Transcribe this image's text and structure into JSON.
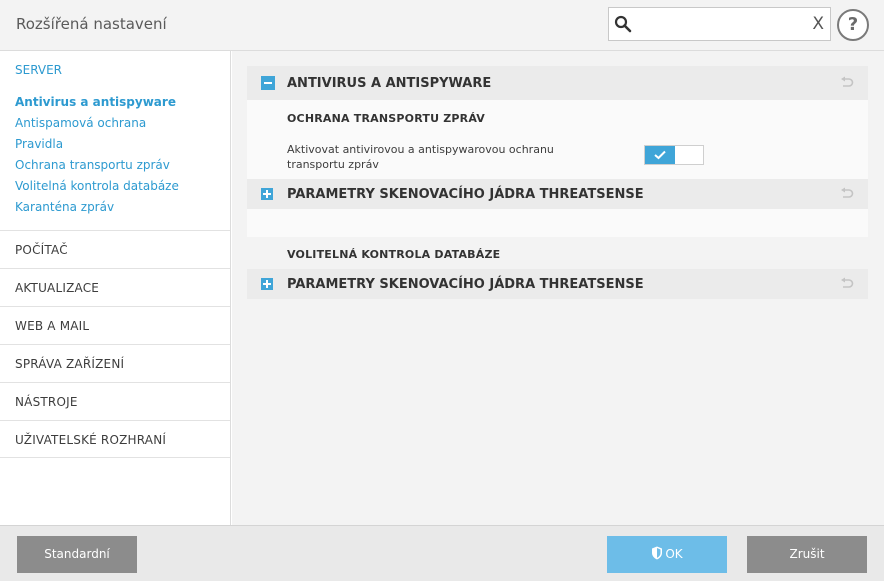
{
  "header": {
    "title": "Rozšířená nastavení",
    "search_value": "",
    "clear_label": "X",
    "help_label": "?"
  },
  "sidebar": {
    "section_link": "SERVER",
    "subitems": [
      {
        "label": "Antivirus a antispyware",
        "active": true
      },
      {
        "label": "Antispamová ochrana"
      },
      {
        "label": "Pravidla"
      },
      {
        "label": "Ochrana transportu zpráv"
      },
      {
        "label": "Volitelná kontrola databáze"
      },
      {
        "label": "Karanténa zpráv"
      }
    ],
    "categories": [
      "POČÍTAČ",
      "AKTUALIZACE",
      "WEB A MAIL",
      "SPRÁVA ZAŘÍZENÍ",
      "NÁSTROJE",
      "UŽIVATELSKÉ ROZHRANÍ"
    ]
  },
  "main": {
    "section_title": "ANTIVIRUS A ANTISPYWARE",
    "transport": {
      "heading": "OCHRANA TRANSPORTU ZPRÁV",
      "option_label": "Aktivovat antivirovou a antispywarovou ochranu transportu zpráv",
      "toggle_on": true
    },
    "engine_params_1": "PARAMETRY SKENOVACÍHO JÁDRA THREATSENSE",
    "db_heading": "VOLITELNÁ KONTROLA DATABÁZE",
    "engine_params_2": "PARAMETRY SKENOVACÍHO JÁDRA THREATSENSE"
  },
  "footer": {
    "standard_label": "Standardní",
    "ok_label": "OK",
    "cancel_label": "Zrušit"
  },
  "colors": {
    "accent": "#3fa5d8",
    "link": "#2d9ad0",
    "ok_button": "#6dbde8",
    "gray_button": "#8c8c8c"
  }
}
